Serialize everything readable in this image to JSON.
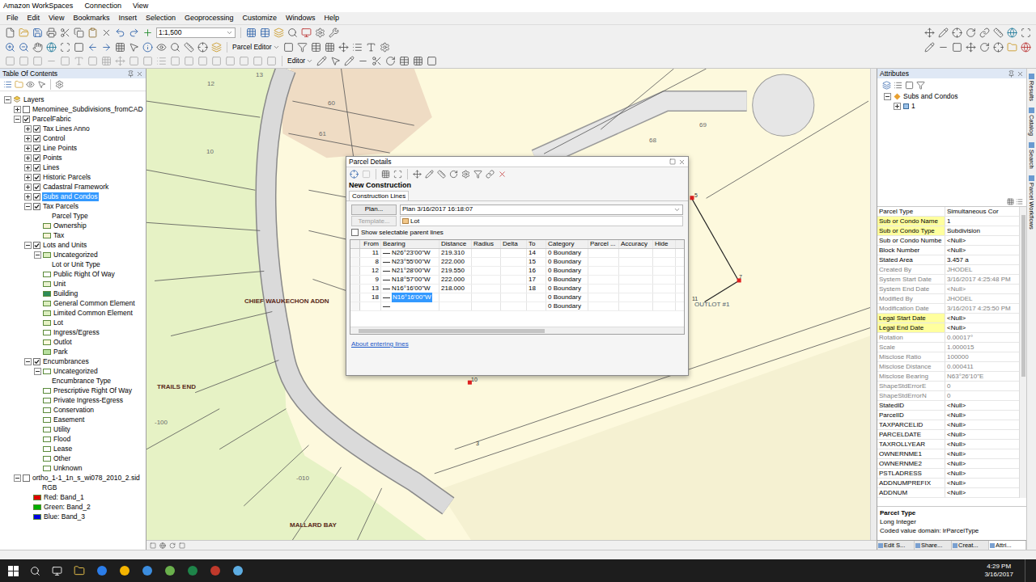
{
  "workspaces_bar": {
    "title": "Amazon WorkSpaces",
    "menus": [
      "Connection",
      "View"
    ]
  },
  "menu_bar": [
    "File",
    "Edit",
    "View",
    "Bookmarks",
    "Insert",
    "Selection",
    "Geoprocessing",
    "Customize",
    "Windows",
    "Help"
  ],
  "toolbar": {
    "scale": "1:1,500",
    "parcel_editor": "Parcel Editor",
    "editor": "Editor"
  },
  "toc": {
    "title": "Table Of Contents",
    "items": [
      {
        "label": "Layers",
        "level": 0,
        "kind": "root",
        "expanded": true
      },
      {
        "label": "Menominee_Subdivisions_fromCAD",
        "level": 1,
        "kind": "layer",
        "checked": false,
        "expanded": false,
        "selected": false
      },
      {
        "label": "ParcelFabric",
        "level": 1,
        "kind": "layer",
        "checked": true,
        "expanded": true,
        "selected": false
      },
      {
        "label": "Tax Lines Anno",
        "level": 2,
        "kind": "layer",
        "checked": true,
        "expanded": false,
        "selected": false
      },
      {
        "label": "Control",
        "level": 2,
        "kind": "layer",
        "checked": true,
        "expanded": false,
        "selected": false
      },
      {
        "label": "Line Points",
        "level": 2,
        "kind": "layer",
        "checked": true,
        "expanded": false,
        "selected": false
      },
      {
        "label": "Points",
        "level": 2,
        "kind": "layer",
        "checked": true,
        "expanded": false,
        "selected": false
      },
      {
        "label": "Lines",
        "level": 2,
        "kind": "layer",
        "checked": true,
        "expanded": false,
        "selected": false
      },
      {
        "label": "Historic Parcels",
        "level": 2,
        "kind": "layer",
        "checked": true,
        "expanded": false,
        "selected": false
      },
      {
        "label": "Cadastral Framework",
        "level": 2,
        "kind": "layer",
        "checked": true,
        "expanded": false,
        "selected": false
      },
      {
        "label": "Subs and Condos",
        "level": 2,
        "kind": "layer",
        "checked": true,
        "expanded": false,
        "selected": true
      },
      {
        "label": "Tax Parcels",
        "level": 2,
        "kind": "layer",
        "checked": true,
        "expanded": true,
        "selected": false
      },
      {
        "label": "Parcel Type",
        "level": 3,
        "kind": "heading"
      },
      {
        "label": "Ownership",
        "level": 3,
        "kind": "legend",
        "color": "#f7f3d6"
      },
      {
        "label": "Tax",
        "level": 3,
        "kind": "legend",
        "color": "#f7f3d6"
      },
      {
        "label": "Lots and Units",
        "level": 2,
        "kind": "layer",
        "checked": true,
        "expanded": true,
        "selected": false
      },
      {
        "label": "Uncategorized",
        "level": 3,
        "kind": "legend",
        "expanded": true,
        "color": "#dcefc0"
      },
      {
        "label": "Lot or Unit Type",
        "level": 3,
        "kind": "heading"
      },
      {
        "label": "Public Right Of Way",
        "level": 3,
        "kind": "legend",
        "color": "#ffffff"
      },
      {
        "label": "Unit",
        "level": 3,
        "kind": "legend",
        "color": "#e9f3d0"
      },
      {
        "label": "Building",
        "level": 3,
        "kind": "legend",
        "color": "#2e8b57"
      },
      {
        "label": "General Common Element",
        "level": 3,
        "kind": "legend",
        "color": "#dcefc0"
      },
      {
        "label": "Limited Common Element",
        "level": 3,
        "kind": "legend",
        "color": "#dcefc0"
      },
      {
        "label": "Lot",
        "level": 3,
        "kind": "legend",
        "color": "#e6f2c5"
      },
      {
        "label": "Ingress/Egress",
        "level": 3,
        "kind": "legend",
        "color": "#ffffff"
      },
      {
        "label": "Outlot",
        "level": 3,
        "kind": "legend",
        "color": "#fdf9dd"
      },
      {
        "label": "Park",
        "level": 3,
        "kind": "legend",
        "color": "#b8e0a0"
      },
      {
        "label": "Encumbrances",
        "level": 2,
        "kind": "layer",
        "checked": true,
        "expanded": true,
        "selected": false
      },
      {
        "label": "Uncategorized",
        "level": 3,
        "kind": "legend",
        "expanded": true,
        "color": "#ffffff"
      },
      {
        "label": "Encumbrance Type",
        "level": 3,
        "kind": "heading"
      },
      {
        "label": "Prescriptive Right Of Way",
        "level": 3,
        "kind": "legend",
        "color": "#ffffff"
      },
      {
        "label": "Private Ingress-Egress",
        "level": 3,
        "kind": "legend",
        "color": "#ffffff"
      },
      {
        "label": "Conservation",
        "level": 3,
        "kind": "legend",
        "color": "#ffffff"
      },
      {
        "label": "Easement",
        "level": 3,
        "kind": "legend",
        "color": "#ffffff"
      },
      {
        "label": "Utility",
        "level": 3,
        "kind": "legend",
        "color": "#ffffff"
      },
      {
        "label": "Flood",
        "level": 3,
        "kind": "legend",
        "color": "#ffffff"
      },
      {
        "label": "Lease",
        "level": 3,
        "kind": "legend",
        "color": "#ffffff"
      },
      {
        "label": "Other",
        "level": 3,
        "kind": "legend",
        "color": "#ffffff"
      },
      {
        "label": "Unknown",
        "level": 3,
        "kind": "legend",
        "color": "#ffffff"
      },
      {
        "label": "ortho_1-1_1n_s_wi078_2010_2.sid",
        "level": 1,
        "kind": "layer",
        "checked": false,
        "expanded": true,
        "selected": false
      },
      {
        "label": "RGB",
        "level": 2,
        "kind": "heading"
      },
      {
        "label": "Red:   Band_1",
        "level": 2,
        "kind": "legend",
        "color": "#e00000"
      },
      {
        "label": "Green: Band_2",
        "level": 2,
        "kind": "legend",
        "color": "#00b000"
      },
      {
        "label": "Blue:  Band_3",
        "level": 2,
        "kind": "legend",
        "color": "#0000e0"
      }
    ]
  },
  "map": {
    "labels": [
      {
        "text": "12",
        "kind": "number"
      },
      {
        "text": "13",
        "kind": "number"
      },
      {
        "text": "10",
        "kind": "number"
      },
      {
        "text": "60",
        "kind": "number"
      },
      {
        "text": "61",
        "kind": "number"
      },
      {
        "text": "69",
        "kind": "number"
      },
      {
        "text": "68",
        "kind": "number"
      },
      {
        "text": "CHIEF WAUKECHON ADDN",
        "kind": "name"
      },
      {
        "text": "TRAILS END",
        "kind": "name"
      },
      {
        "text": "-100",
        "kind": "number"
      },
      {
        "text": "-010",
        "kind": "number"
      },
      {
        "text": "MALLARD BAY",
        "kind": "name"
      },
      {
        "text": "OUTLOT #1",
        "kind": "outlot"
      },
      {
        "text": "5",
        "kind": "point"
      },
      {
        "text": "7",
        "kind": "point"
      },
      {
        "text": "11",
        "kind": "point"
      },
      {
        "text": "3",
        "kind": "point"
      },
      {
        "text": "10",
        "kind": "point"
      }
    ]
  },
  "parcel_details": {
    "title": "Parcel Details",
    "heading": "New Construction",
    "tab": "Construction Lines",
    "plan_button": "Plan...",
    "plan": "Plan 3/16/2017 16:18:07",
    "template_button": "Template...",
    "template_disabled": true,
    "template": "Lot",
    "show_parent_lines": {
      "label": "Show selectable parent lines",
      "checked": false
    },
    "columns": [
      "From",
      "Bearing",
      "Distance",
      "Radius",
      "Delta",
      "To",
      "Category",
      "Parcel ...",
      "Accuracy",
      "Hide"
    ],
    "rows": [
      {
        "from": "11",
        "bearing": "N26°23'00\"W",
        "distance": "219.310",
        "to": "14",
        "category": "0 Boundary",
        "selected": false
      },
      {
        "from": "8",
        "bearing": "N23°55'00\"W",
        "distance": "222.000",
        "to": "15",
        "category": "0 Boundary",
        "selected": false
      },
      {
        "from": "12",
        "bearing": "N21°28'00\"W",
        "distance": "219.550",
        "to": "16",
        "category": "0 Boundary",
        "selected": false
      },
      {
        "from": "9",
        "bearing": "N18°57'00\"W",
        "distance": "222.000",
        "to": "17",
        "category": "0 Boundary",
        "selected": false
      },
      {
        "from": "13",
        "bearing": "N16°16'00\"W",
        "distance": "218.000",
        "to": "18",
        "category": "0 Boundary",
        "selected": false
      },
      {
        "from": "18",
        "bearing": "N16°16'00\"W",
        "distance": "",
        "to": "",
        "category": "0 Boundary",
        "selected": true
      },
      {
        "from": "",
        "bearing": "",
        "distance": "",
        "to": "",
        "category": "0 Boundary",
        "selected": false
      }
    ],
    "link": "About entering lines"
  },
  "attributes": {
    "title": "Attributes",
    "tree": [
      "Subs and Condos",
      "1"
    ],
    "rows": [
      {
        "name": "Parcel Type",
        "value": "Simultaneous Cor",
        "kind": "normal"
      },
      {
        "name": "Sub or Condo Name",
        "value": "1",
        "kind": "required"
      },
      {
        "name": "Sub or Condo Type",
        "value": "Subdivision",
        "kind": "required"
      },
      {
        "name": "Sub or Condo Numbe",
        "value": "<Null>",
        "kind": "normal"
      },
      {
        "name": "Block Number",
        "value": "<Null>",
        "kind": "normal"
      },
      {
        "name": "Stated Area",
        "value": "3.457 a",
        "kind": "normal"
      },
      {
        "name": "Created By",
        "value": "JHODEL",
        "kind": "readonly"
      },
      {
        "name": "System Start Date",
        "value": "3/16/2017 4:25:48 PM",
        "kind": "readonly"
      },
      {
        "name": "System End Date",
        "value": "<Null>",
        "kind": "readonly"
      },
      {
        "name": "Modified By",
        "value": "JHODEL",
        "kind": "readonly"
      },
      {
        "name": "Modification Date",
        "value": "3/16/2017 4:25:50 PM",
        "kind": "readonly"
      },
      {
        "name": "Legal Start Date",
        "value": "<Null>",
        "kind": "required"
      },
      {
        "name": "Legal End Date",
        "value": "<Null>",
        "kind": "required"
      },
      {
        "name": "Rotation",
        "value": "0.00017°",
        "kind": "readonly"
      },
      {
        "name": "Scale",
        "value": "1.000015",
        "kind": "readonly"
      },
      {
        "name": "Misclose Ratio",
        "value": "100000",
        "kind": "readonly"
      },
      {
        "name": "Misclose Distance",
        "value": "0.000411",
        "kind": "readonly"
      },
      {
        "name": "Misclose Bearing",
        "value": "N63°26'10\"E",
        "kind": "readonly"
      },
      {
        "name": "ShapeStdErrorE",
        "value": "0",
        "kind": "readonly"
      },
      {
        "name": "ShapeStdErrorN",
        "value": "0",
        "kind": "readonly"
      },
      {
        "name": "StatedID",
        "value": "<Null>",
        "kind": "normal"
      },
      {
        "name": "ParcelID",
        "value": "<Null>",
        "kind": "normal"
      },
      {
        "name": "TAXPARCELID",
        "value": "<Null>",
        "kind": "normal"
      },
      {
        "name": "PARCELDATE",
        "value": "<Null>",
        "kind": "normal"
      },
      {
        "name": "TAXROLLYEAR",
        "value": "<Null>",
        "kind": "normal"
      },
      {
        "name": "OWNERNME1",
        "value": "<Null>",
        "kind": "normal"
      },
      {
        "name": "OWNERNME2",
        "value": "<Null>",
        "kind": "normal"
      },
      {
        "name": "PSTLADRESS",
        "value": "<Null>",
        "kind": "normal"
      },
      {
        "name": "ADDNUMPREFIX",
        "value": "<Null>",
        "kind": "normal"
      },
      {
        "name": "ADDNUM",
        "value": "<Null>",
        "kind": "normal"
      }
    ],
    "description": {
      "title": "Parcel Type",
      "lines": [
        "Long Integer",
        "Coded value domain: lrParcelType"
      ]
    },
    "tabs": [
      {
        "label": "Edit S...",
        "selected": false
      },
      {
        "label": "Share...",
        "selected": false
      },
      {
        "label": "Creat...",
        "selected": false
      },
      {
        "label": "Attri...",
        "selected": true
      }
    ]
  },
  "side_tabs": [
    "Results",
    "Catalog",
    "Search",
    "Parcel Workflows"
  ],
  "taskbar": {
    "time": "4:29 PM",
    "date": "3/16/2017"
  }
}
